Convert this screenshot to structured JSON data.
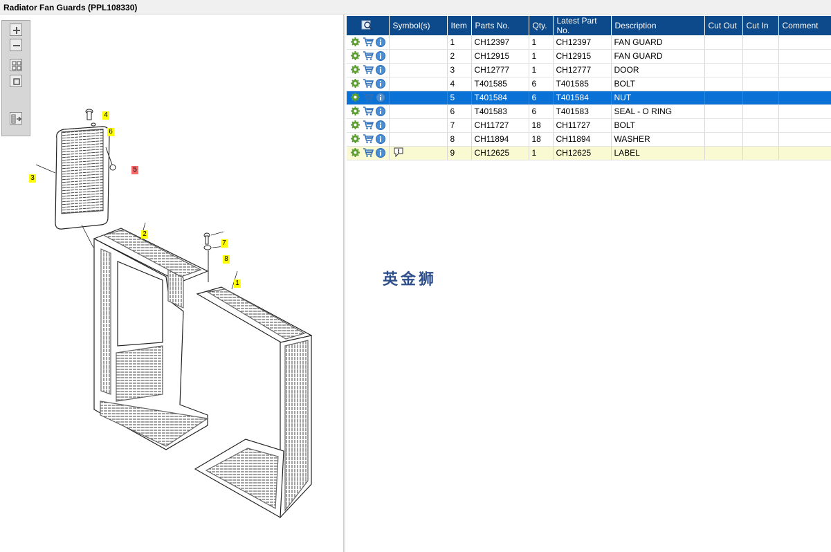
{
  "title": "Radiator Fan Guards (PPL108330)",
  "toolbar": {
    "zoom_in_icon": "zoom-in-icon",
    "zoom_out_icon": "zoom-out-icon",
    "fit_icon": "fit-all-icon",
    "actual_size_icon": "actual-size-icon",
    "export_icon": "export-list-icon"
  },
  "callouts": [
    {
      "label": "1",
      "selected": false
    },
    {
      "label": "2",
      "selected": false
    },
    {
      "label": "3",
      "selected": false
    },
    {
      "label": "4",
      "selected": false
    },
    {
      "label": "5",
      "selected": true
    },
    {
      "label": "6",
      "selected": false
    },
    {
      "label": "7",
      "selected": false
    },
    {
      "label": "8",
      "selected": false
    }
  ],
  "table": {
    "columns": [
      "",
      "Symbol(s)",
      "Item",
      "Parts No.",
      "Qty.",
      "Latest Part No.",
      "Description",
      "Cut Out",
      "Cut In",
      "Comment"
    ],
    "rows": [
      {
        "symbol": "",
        "item": "1",
        "part_no": "CH12397",
        "qty": "1",
        "latest": "CH12397",
        "desc": "FAN GUARD",
        "cut_out": "",
        "cut_in": "",
        "comment": ""
      },
      {
        "symbol": "",
        "item": "2",
        "part_no": "CH12915",
        "qty": "1",
        "latest": "CH12915",
        "desc": "FAN GUARD",
        "cut_out": "",
        "cut_in": "",
        "comment": ""
      },
      {
        "symbol": "",
        "item": "3",
        "part_no": "CH12777",
        "qty": "1",
        "latest": "CH12777",
        "desc": "DOOR",
        "cut_out": "",
        "cut_in": "",
        "comment": ""
      },
      {
        "symbol": "",
        "item": "4",
        "part_no": "T401585",
        "qty": "6",
        "latest": "T401585",
        "desc": "BOLT",
        "cut_out": "",
        "cut_in": "",
        "comment": ""
      },
      {
        "symbol": "",
        "item": "5",
        "part_no": "T401584",
        "qty": "6",
        "latest": "T401584",
        "desc": "NUT",
        "cut_out": "",
        "cut_in": "",
        "comment": ""
      },
      {
        "symbol": "",
        "item": "6",
        "part_no": "T401583",
        "qty": "6",
        "latest": "T401583",
        "desc": "SEAL - O RING",
        "cut_out": "",
        "cut_in": "",
        "comment": ""
      },
      {
        "symbol": "",
        "item": "7",
        "part_no": "CH11727",
        "qty": "18",
        "latest": "CH11727",
        "desc": "BOLT",
        "cut_out": "",
        "cut_in": "",
        "comment": ""
      },
      {
        "symbol": "",
        "item": "8",
        "part_no": "CH11894",
        "qty": "18",
        "latest": "CH11894",
        "desc": "WASHER",
        "cut_out": "",
        "cut_in": "",
        "comment": ""
      },
      {
        "symbol": "note-icon",
        "item": "9",
        "part_no": "CH12625",
        "qty": "1",
        "latest": "CH12625",
        "desc": "LABEL",
        "cut_out": "",
        "cut_in": "",
        "comment": ""
      }
    ],
    "selected_row": 4,
    "highlight_row": 8
  },
  "watermark": "英金狮",
  "colors": {
    "header_bg": "#0d4a8c",
    "selected_bg": "#0a72d6",
    "highlight_bg": "#fafad2",
    "callout": "#ffff00",
    "callout_selected": "#f56b6b"
  }
}
